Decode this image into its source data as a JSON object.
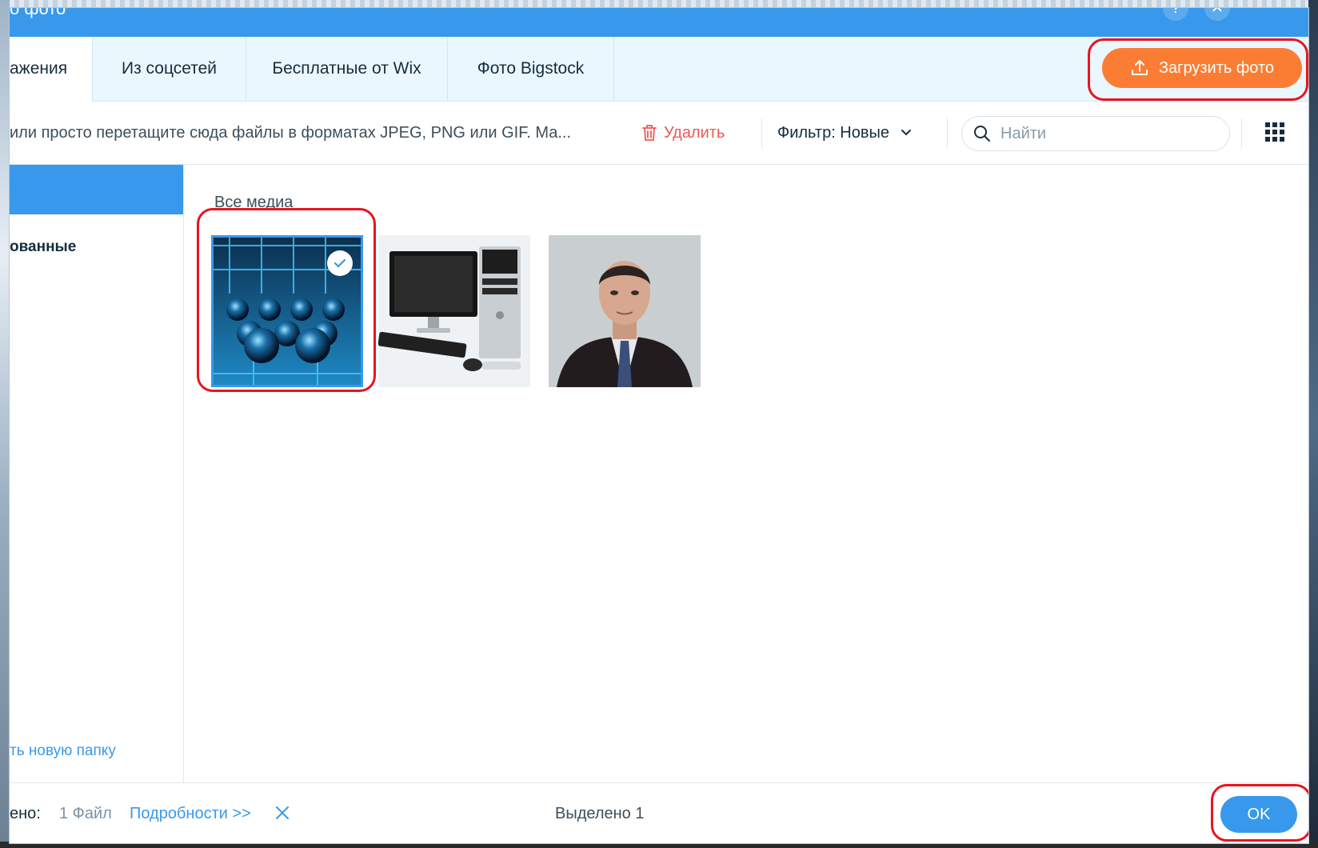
{
  "window": {
    "title": "о фото",
    "help_label": "?",
    "close_label": "✕"
  },
  "tabs": [
    {
      "label": "ажения",
      "active": true
    },
    {
      "label": "Из соцсетей",
      "active": false
    },
    {
      "label": "Бесплатные от Wix",
      "active": false
    },
    {
      "label": "Фото Bigstock",
      "active": false
    }
  ],
  "upload": {
    "label": "Загрузить фото"
  },
  "toolbar": {
    "hint": "или просто перетащите сюда файлы в форматах JPEG, PNG или GIF. Ма...",
    "delete_label": "Удалить",
    "filter_label": "Фильтр: Новые",
    "search_placeholder": "Найти"
  },
  "sidebar": {
    "item_label": "ованные",
    "new_folder_label": "ть новую папку"
  },
  "content": {
    "section_title": "Все медиа",
    "thumbnails": [
      {
        "name": "abstract-spheres",
        "selected": true
      },
      {
        "name": "desktop-computer",
        "selected": false
      },
      {
        "name": "portrait-man",
        "selected": false
      }
    ]
  },
  "footer": {
    "uploaded_label": "ено:",
    "file_count": "1 Файл",
    "details_link": "Подробности >>",
    "selected_text": "Выделено 1",
    "ok_label": "OK"
  },
  "colors": {
    "accent": "#3899ec",
    "upload": "#fb7d33",
    "delete": "#ee5951",
    "highlight": "#e8141f"
  },
  "icons": [
    "upload-icon",
    "trash-icon",
    "chevron-down-icon",
    "search-icon",
    "grid-view-icon",
    "check-icon",
    "close-icon"
  ]
}
